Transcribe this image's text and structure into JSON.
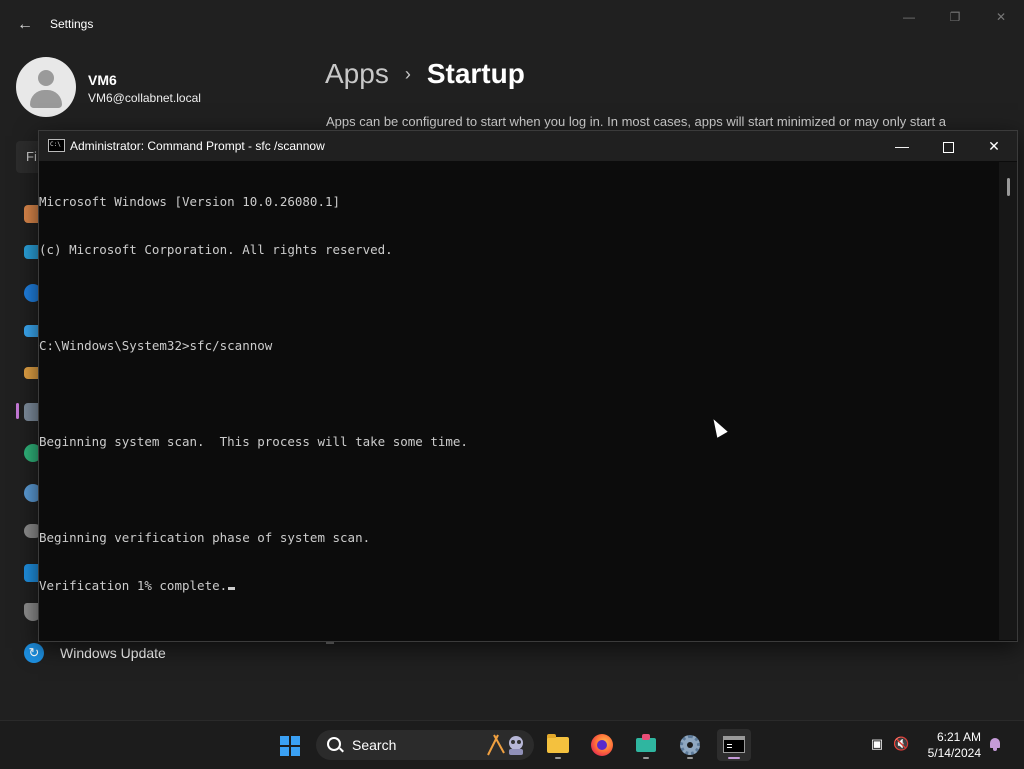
{
  "settings": {
    "window_title": "Settings",
    "user": {
      "name": "VM6",
      "email": "VM6@collabnet.local"
    },
    "breadcrumb": {
      "parent": "Apps",
      "current": "Startup"
    },
    "description": "Apps can be configured to start when you log in. In most cases, apps will start minimized or may only start a",
    "find_placeholder": "Fi",
    "sidebar_bottom_item": "Windows Update",
    "icons": [
      "home-icon",
      "system-icon",
      "bluetooth-icon",
      "network-icon",
      "personalization-icon",
      "apps-icon",
      "accounts-icon",
      "time-language-icon",
      "gaming-icon",
      "accessibility-icon",
      "privacy-icon",
      "windows-update-icon"
    ],
    "selected_color": "#c478d6"
  },
  "cmd": {
    "title": "Administrator: Command Prompt - sfc /scannow",
    "lines": [
      "Microsoft Windows [Version 10.0.26080.1]",
      "(c) Microsoft Corporation. All rights reserved.",
      "",
      "C:\\Windows\\System32>sfc/scannow",
      "",
      "Beginning system scan.  This process will take some time.",
      "",
      "Beginning verification phase of system scan.",
      "Verification 1% complete."
    ]
  },
  "taskbar": {
    "search_label": "Search",
    "apps": [
      "start-icon",
      "file-explorer-icon",
      "firefox-icon",
      "snipping-tool-icon",
      "settings-icon",
      "terminal-icon"
    ],
    "active_app": "terminal-icon",
    "clock": {
      "time": "6:21 AM",
      "date": "5/14/2024"
    },
    "accent": "#c59bd8"
  }
}
